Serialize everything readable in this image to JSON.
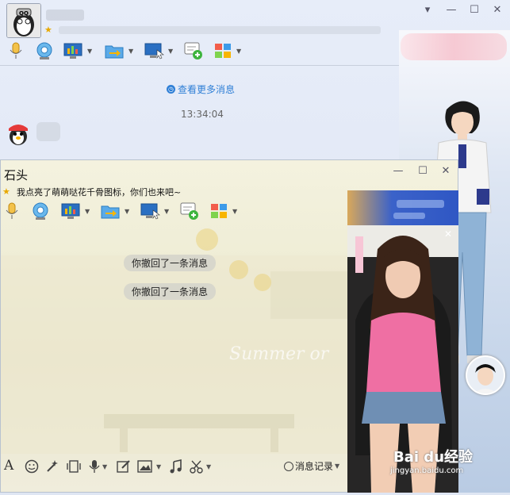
{
  "back_window": {
    "more_messages": "查看更多消息",
    "timestamp": "13:34:04",
    "window_controls": [
      "▾",
      "—",
      "☐",
      "✕"
    ]
  },
  "front_window": {
    "contact_name": "石头",
    "status_message": "我点亮了萌萌哒花千骨图标，你们也来吧~",
    "window_controls": [
      "—",
      "☐",
      "✕"
    ],
    "messages": [
      "你撤回了一条消息",
      "你撤回了一条消息"
    ],
    "background_text": "Summer or",
    "history_label": "消息记录"
  },
  "icons": {
    "toolbar": [
      "microphone-icon",
      "webcam-icon",
      "screen-share-icon",
      "file-transfer-icon",
      "remote-desktop-icon",
      "new-discussion-icon",
      "apps-grid-icon"
    ],
    "input_toolbar": [
      "font-icon",
      "emoji-icon",
      "magic-icon",
      "screen-shake-icon",
      "voice-message-icon",
      "doodle-icon",
      "image-icon",
      "music-icon",
      "screenshot-icon"
    ]
  },
  "watermark": {
    "brand": "Bai du经验",
    "url": "jingyan.baidu.com"
  },
  "colors": {
    "accent_blue": "#2f7fd6",
    "pill_bg": "#d8d7cc"
  }
}
